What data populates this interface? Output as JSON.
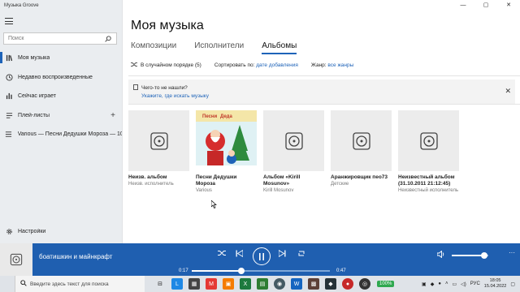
{
  "app": {
    "title": "Музыка Groove",
    "window_controls": [
      "—",
      "▢",
      "✕"
    ]
  },
  "sidebar": {
    "search_placeholder": "Поиск",
    "items": [
      {
        "label": "Моя музыка",
        "icon": "music-library-icon",
        "active": true
      },
      {
        "label": "Недавно воспроизведенные",
        "icon": "recent-icon"
      },
      {
        "label": "Сейчас играет",
        "icon": "now-playing-icon"
      },
      {
        "label": "Плей-листы",
        "icon": "playlist-icon"
      },
      {
        "label": "Various — Песни Дедушки Мороза — 10",
        "icon": "playlist-item-icon"
      },
      {
        "label": "Настройки",
        "icon": "gear-icon"
      }
    ]
  },
  "main": {
    "title": "Моя музыка",
    "tabs": [
      {
        "label": "Композиции"
      },
      {
        "label": "Исполнители"
      },
      {
        "label": "Альбомы",
        "active": true
      }
    ],
    "toolbar": {
      "shuffle": "В случайном порядке (5)",
      "sort_label": "Сортировать по:",
      "sort_value": "дате добавления",
      "genre_label": "Жанр:",
      "genre_value": "все жанры"
    },
    "notice": {
      "question": "Чего-то не нашли?",
      "link": "Укажите, где искать музыку"
    },
    "albums": [
      {
        "title": "Неизв. альбом",
        "artist": "Неизв. исполнитель",
        "cover": "disc"
      },
      {
        "title": "Песни Дедушки Мороза",
        "artist": "Various",
        "cover": "art"
      },
      {
        "title": "Альбом «Kirill Mosunov»",
        "artist": "Kirill Mosunov",
        "cover": "disc"
      },
      {
        "title": "Аранжировщик пео73",
        "artist": "Детские",
        "cover": "disc"
      },
      {
        "title": "Неизвестный альбом (31.10.2011 21:12:45)",
        "artist": "Неизвестный исполнитель",
        "cover": "disc"
      }
    ]
  },
  "player": {
    "track": "боатишкин и майнкрафт",
    "elapsed": "0:17",
    "duration": "0:47",
    "progress": 0.36,
    "volume": 0.88
  },
  "taskbar": {
    "search_placeholder": "Введите здесь текст для поиска",
    "battery": "100%",
    "language": "РУС",
    "time": "18:05",
    "date": "15.04.2022"
  },
  "colors": {
    "accent": "#1e63b8",
    "player_bg": "#1f5fb0"
  }
}
